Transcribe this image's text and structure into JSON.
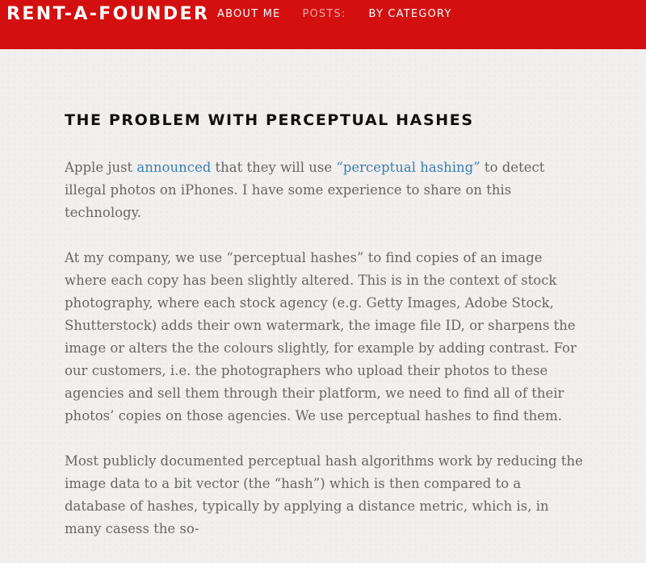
{
  "header": {
    "site_title": "RENT-A-FOUNDER",
    "nav": {
      "about": "ABOUT ME",
      "posts": "POSTS:",
      "category": "BY CATEGORY"
    },
    "background_color": "#d30f0f"
  },
  "post": {
    "title": "THE PROBLEM WITH PERCEPTUAL HASHES",
    "p1": {
      "t1": "Apple just ",
      "link1": "announced",
      "t2": " that they will use ",
      "link2": "“perceptual hashing”",
      "t3": " to detect illegal photos on iPhones. I have some experience to share on this technology."
    },
    "p2": "At my company, we use “perceptual hashes” to find copies of an image where each copy has been slightly altered. This is in the context of stock photography, where each stock agency (e.g. Getty Images, Adobe Stock, Shutterstock) adds their own watermark, the image file ID, or sharpens the image or alters the the colours slightly, for example by adding contrast. For our customers, i.e. the photographers who upload their photos to these agencies and sell them through their platform, we need to find all of their photos’ copies on those agencies. We use perceptual hashes to find them.",
    "p3": "Most publicly documented perceptual hash algorithms work by reducing the image data to a bit vector (the “hash”) which is then compared to a database of hashes, typically by applying a distance metric, which is, in many casess the so-"
  },
  "colors": {
    "link": "#3a7fb0",
    "body_text": "#666666",
    "title_text": "#111111",
    "nav_muted": "#f3a6a6"
  }
}
